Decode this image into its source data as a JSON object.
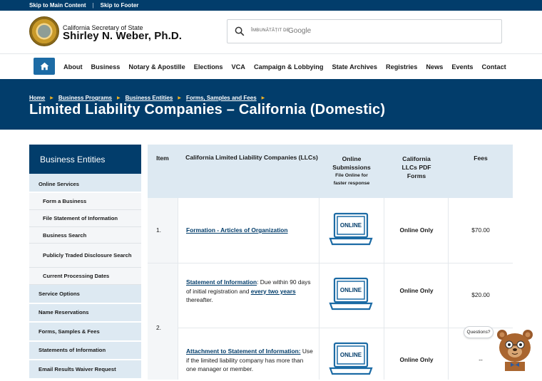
{
  "skip": {
    "main": "Skip to Main Content",
    "footer": "Skip to Footer"
  },
  "header": {
    "office": "California Secretary of State",
    "name": "Shirley N. Weber, Ph.D."
  },
  "search": {
    "enhanced": "ÎMBUNĂTĂȚIT DE",
    "brand": "Google"
  },
  "nav": {
    "items": [
      "About",
      "Business",
      "Notary & Apostille",
      "Elections",
      "VCA",
      "Campaign & Lobbying",
      "State Archives",
      "Registries",
      "News",
      "Events",
      "Contact"
    ]
  },
  "breadcrumbs": [
    "Home",
    "Business Programs",
    "Business Entities",
    "Forms, Samples and Fees"
  ],
  "page_title": "Limited Liability Companies – California (Domestic)",
  "sidebar": {
    "title": "Business Entities",
    "online_services": "Online Services",
    "sub_items": [
      "Form a Business",
      "File Statement of Information",
      "Business Search",
      "Publicly Traded Disclosure Search",
      "Current Processing Dates"
    ],
    "items": [
      "Service Options",
      "Name Reservations",
      "Forms, Samples & Fees",
      "Statements of Information",
      "Email Results Waiver Request"
    ]
  },
  "table": {
    "headers": {
      "item": "Item",
      "llcs": "California Limited Liability Companies (LLCs)",
      "online_title": "Online Submissions",
      "online_sub": "File Online for faster response",
      "pdf": "California LLCs PDF Forms",
      "fees": "Fees"
    },
    "laptop_label": "ONLINE",
    "rows": [
      {
        "item": "1.",
        "link": "Formation - Articles of Organization",
        "pdf": "Online Only",
        "fee": "$70.00"
      },
      {
        "item": "2.",
        "link": "Statement of Information",
        "text_a": ": Due within 90 days of initial registration and ",
        "link2": "every two years",
        "text_b": " thereafter.",
        "pdf": "Online Only",
        "fee": "$20.00"
      },
      {
        "link": "Attachment to Statement of Information:",
        "text_a": " Use if the limited liability company has more than one manager or member.",
        "pdf": "Online Only",
        "fee": "--"
      }
    ]
  },
  "chat": {
    "bubble": "Questions?"
  }
}
